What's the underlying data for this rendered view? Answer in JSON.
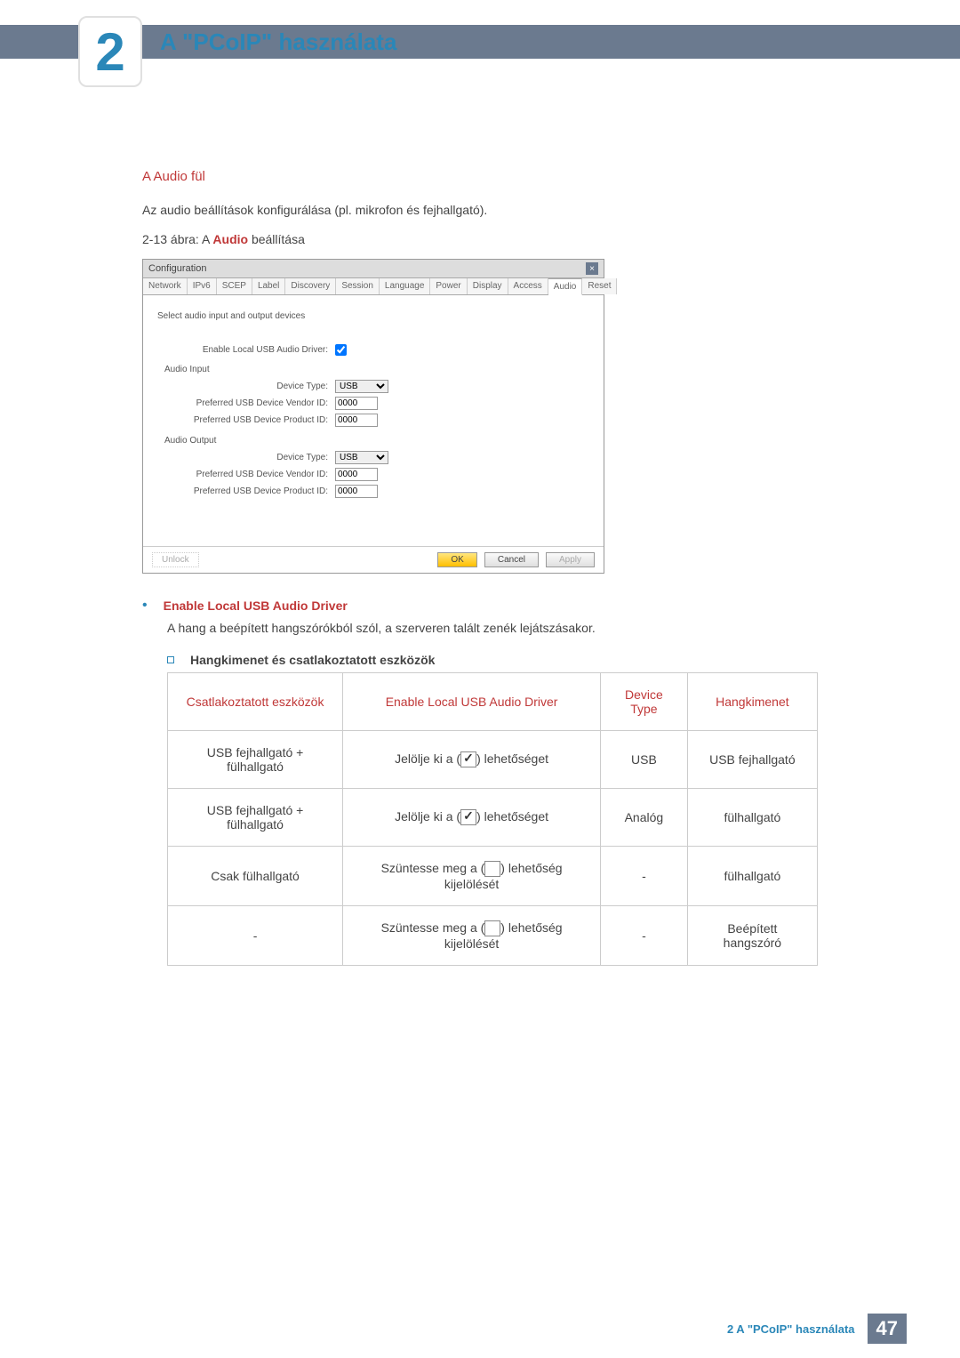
{
  "chapter": {
    "number": "2",
    "title": "A \"PCoIP\" használata"
  },
  "section": {
    "title": "A Audio fül"
  },
  "intro": "Az audio beállítások konfigurálása (pl. mikrofon és fejhallgató).",
  "caption": {
    "prefix": "2-13 ábra: A ",
    "bold": "Audio",
    "suffix": " beállítása"
  },
  "win": {
    "title": "Configuration",
    "tabs": [
      "Network",
      "IPv6",
      "SCEP",
      "Label",
      "Discovery",
      "Session",
      "Language",
      "Power",
      "Display",
      "Access",
      "Audio",
      "Reset"
    ],
    "active_tab": "Audio",
    "select_label": "Select audio input and output devices",
    "enable_label": "Enable Local USB Audio Driver:",
    "group_in": "Audio Input",
    "group_out": "Audio Output",
    "device_type_label": "Device Type:",
    "device_type_value": "USB",
    "vendor_label": "Preferred USB Device Vendor ID:",
    "product_label": "Preferred USB Device Product ID:",
    "id_value": "0000",
    "unlock": "Unlock",
    "ok": "OK",
    "cancel": "Cancel",
    "apply": "Apply"
  },
  "enable_item": {
    "title": "Enable Local USB Audio Driver",
    "desc": "A hang a beépített hangszórókból szól, a szerveren talált zenék lejátszásakor.",
    "sub_title": "Hangkimenet és csatlakoztatott eszközök"
  },
  "table": {
    "headers": [
      "Csatlakoztatott eszközök",
      "Enable Local USB Audio Driver",
      "Device Type",
      "Hangkimenet"
    ],
    "rows": [
      {
        "c0": "USB fejhallgató + fülhallgató",
        "c1_pre": "Jelölje ki a (",
        "c1_check": true,
        "c1_post": ") lehetőséget",
        "c2": "USB",
        "c3": "USB fejhallgató"
      },
      {
        "c0": "USB fejhallgató + fülhallgató",
        "c1_pre": "Jelölje ki a (",
        "c1_check": true,
        "c1_post": ") lehetőséget",
        "c2": "Analóg",
        "c3": "fülhallgató"
      },
      {
        "c0": "Csak fülhallgató",
        "c1_pre": "Szüntesse meg a (",
        "c1_check": false,
        "c1_post": ") lehetőség kijelölését",
        "c2": "-",
        "c3": "fülhallgató"
      },
      {
        "c0": "-",
        "c1_pre": "Szüntesse meg a (",
        "c1_check": false,
        "c1_post": ") lehetőség kijelölését",
        "c2": "-",
        "c3": "Beépített hangszóró"
      }
    ]
  },
  "footer": {
    "text": "2 A \"PCoIP\" használata",
    "page": "47"
  }
}
